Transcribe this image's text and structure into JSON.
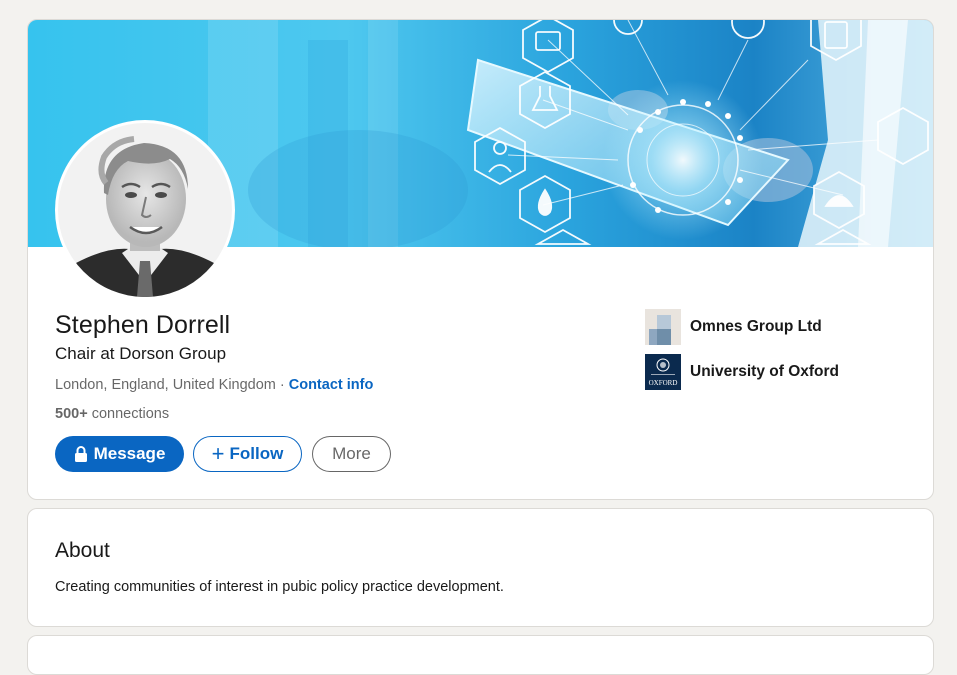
{
  "profile": {
    "name": "Stephen Dorrell",
    "headline": "Chair at Dorson Group",
    "location": "London, England, United Kingdom",
    "separator": "·",
    "contact_info": "Contact info",
    "connections_count": "500+",
    "connections_label": "connections"
  },
  "actions": {
    "message": "Message",
    "follow": "Follow",
    "follow_icon": "+",
    "more": "More"
  },
  "organizations": [
    {
      "name": "Omnes Group Ltd",
      "logo": "omnes-logo"
    },
    {
      "name": "University of Oxford",
      "logo": "oxford-logo",
      "logo_text": "OXFORD"
    }
  ],
  "about": {
    "title": "About",
    "text": "Creating communities of interest in pubic policy practice development."
  },
  "colors": {
    "brand_blue": "#0a66c2",
    "banner_light": "#3cc6ee",
    "banner_dark": "#1a80c4",
    "page_bg": "#f3f2ef"
  }
}
